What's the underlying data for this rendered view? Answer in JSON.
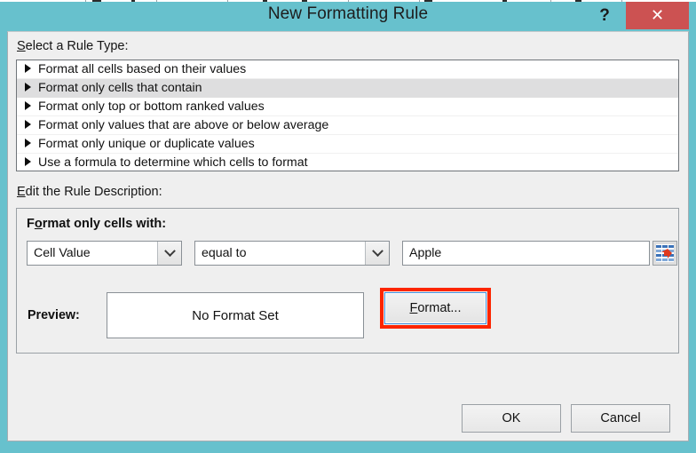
{
  "backdrop": {
    "note": "spreadsheet visible as thin strip above dialog"
  },
  "titlebar": {
    "title": "New Formatting Rule",
    "help_label": "?",
    "close_label": "✕",
    "help_icon": "question-mark-icon",
    "close_icon": "close-x-icon",
    "bar_color": "#67c1cd",
    "close_color": "#cc5252"
  },
  "rule_type": {
    "label": "Select a Rule Type:",
    "label_accel": "S",
    "items": [
      {
        "label": "Format all cells based on their values",
        "selected": false
      },
      {
        "label": "Format only cells that contain",
        "selected": true
      },
      {
        "label": "Format only top or bottom ranked values",
        "selected": false
      },
      {
        "label": "Format only values that are above or below average",
        "selected": false
      },
      {
        "label": "Format only unique or duplicate values",
        "selected": false
      },
      {
        "label": "Use a formula to determine which cells to format",
        "selected": false
      }
    ],
    "bullet_icon": "triangle-right-icon",
    "selected_row_color": "#dededf"
  },
  "rule_description": {
    "label": "Edit the Rule Description:",
    "label_accel": "E",
    "group_heading": "Format only cells with:",
    "group_heading_accel": "o",
    "operand": {
      "value": "Cell Value",
      "arrow_icon": "chevron-down-icon"
    },
    "operator": {
      "value": "equal to",
      "arrow_icon": "chevron-down-icon"
    },
    "value_input": {
      "value": "Apple",
      "placeholder": ""
    },
    "range_picker_icon": "range-select-icon",
    "preview_label": "Preview:",
    "preview_text": "No Format Set",
    "format_button": "Format...",
    "format_button_accel": "F",
    "format_highlight_color": "#fc2500"
  },
  "footer": {
    "ok_label": "OK",
    "cancel_label": "Cancel"
  }
}
